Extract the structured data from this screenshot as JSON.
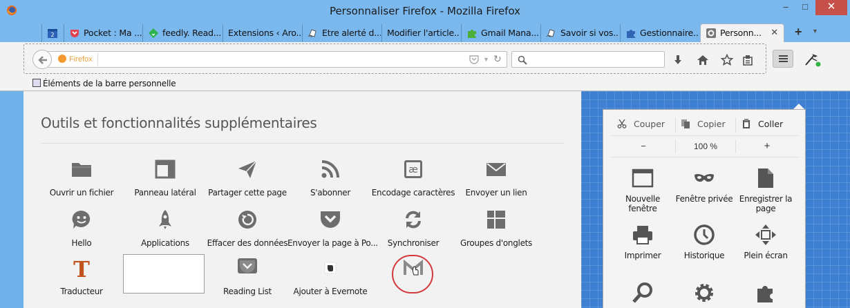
{
  "window": {
    "title": "Personnaliser Firefox - Mozilla Firefox",
    "minimize": "–",
    "maximize": "□",
    "close": "✕"
  },
  "tabs": [
    {
      "label": "",
      "icon": "calendar-icon"
    },
    {
      "label": "Pocket : Ma ...",
      "icon": "pocket-icon"
    },
    {
      "label": "feedly. Read...",
      "icon": "feedly-icon"
    },
    {
      "label": "Extensions ‹ Aro...",
      "icon": ""
    },
    {
      "label": "Etre alerté d...",
      "icon": "page-icon"
    },
    {
      "label": "Modifier l'article...",
      "icon": ""
    },
    {
      "label": "Gmail Mana...",
      "icon": "puzzle-green-icon"
    },
    {
      "label": "Savoir si vos...",
      "icon": "page-icon"
    },
    {
      "label": "Gestionnaire...",
      "icon": "puzzle-blue-icon"
    },
    {
      "label": "Personn...",
      "icon": "gear-icon",
      "active": true,
      "close": "✕"
    }
  ],
  "newtab": "+",
  "tablist": "▼",
  "navbar": {
    "identity": "Firefox",
    "search_placeholder": ""
  },
  "bookmarks": {
    "label": "Éléments de la barre personnelle"
  },
  "palette": {
    "title": "Outils et fonctionnalités supplémentaires",
    "items": [
      {
        "label": "Ouvrir un fichier",
        "icon": "folder-icon"
      },
      {
        "label": "Panneau latéral",
        "icon": "sidebar-icon"
      },
      {
        "label": "Partager cette page",
        "icon": "share-icon"
      },
      {
        "label": "S'abonner",
        "icon": "rss-icon"
      },
      {
        "label": "Encodage caractères",
        "icon": "encoding-icon"
      },
      {
        "label": "Envoyer un lien",
        "icon": "email-icon"
      },
      {
        "label": "Hello",
        "icon": "hello-icon"
      },
      {
        "label": "Applications",
        "icon": "rocket-icon"
      },
      {
        "label": "Effacer des données",
        "icon": "forget-icon"
      },
      {
        "label": "Envoyer la page à Po...",
        "icon": "pocket-icon"
      },
      {
        "label": "Synchroniser",
        "icon": "sync-icon"
      },
      {
        "label": "Groupes d'onglets",
        "icon": "tab-groups-icon"
      },
      {
        "label": "Traducteur",
        "icon": "translator-icon"
      },
      {
        "label": "Reading List",
        "icon": "reading-list-icon"
      },
      {
        "label": "Ajouter à Evernote",
        "icon": "evernote-icon"
      }
    ]
  },
  "menu_panel": {
    "cut": "Couper",
    "copy": "Copier",
    "paste": "Coller",
    "zoom_out": "−",
    "zoom": "100 %",
    "zoom_in": "+",
    "items": [
      {
        "label": "Nouvelle fenêtre",
        "icon": "new-window-icon"
      },
      {
        "label": "Fenêtre privée",
        "icon": "private-mask-icon"
      },
      {
        "label": "Enregistrer la page",
        "icon": "save-page-icon"
      },
      {
        "label": "Imprimer",
        "icon": "print-icon"
      },
      {
        "label": "Historique",
        "icon": "history-icon"
      },
      {
        "label": "Plein écran",
        "icon": "fullscreen-icon"
      },
      {
        "label": "",
        "icon": "search-icon"
      },
      {
        "label": "",
        "icon": "gear-icon"
      },
      {
        "label": "",
        "icon": "addons-icon"
      }
    ]
  }
}
